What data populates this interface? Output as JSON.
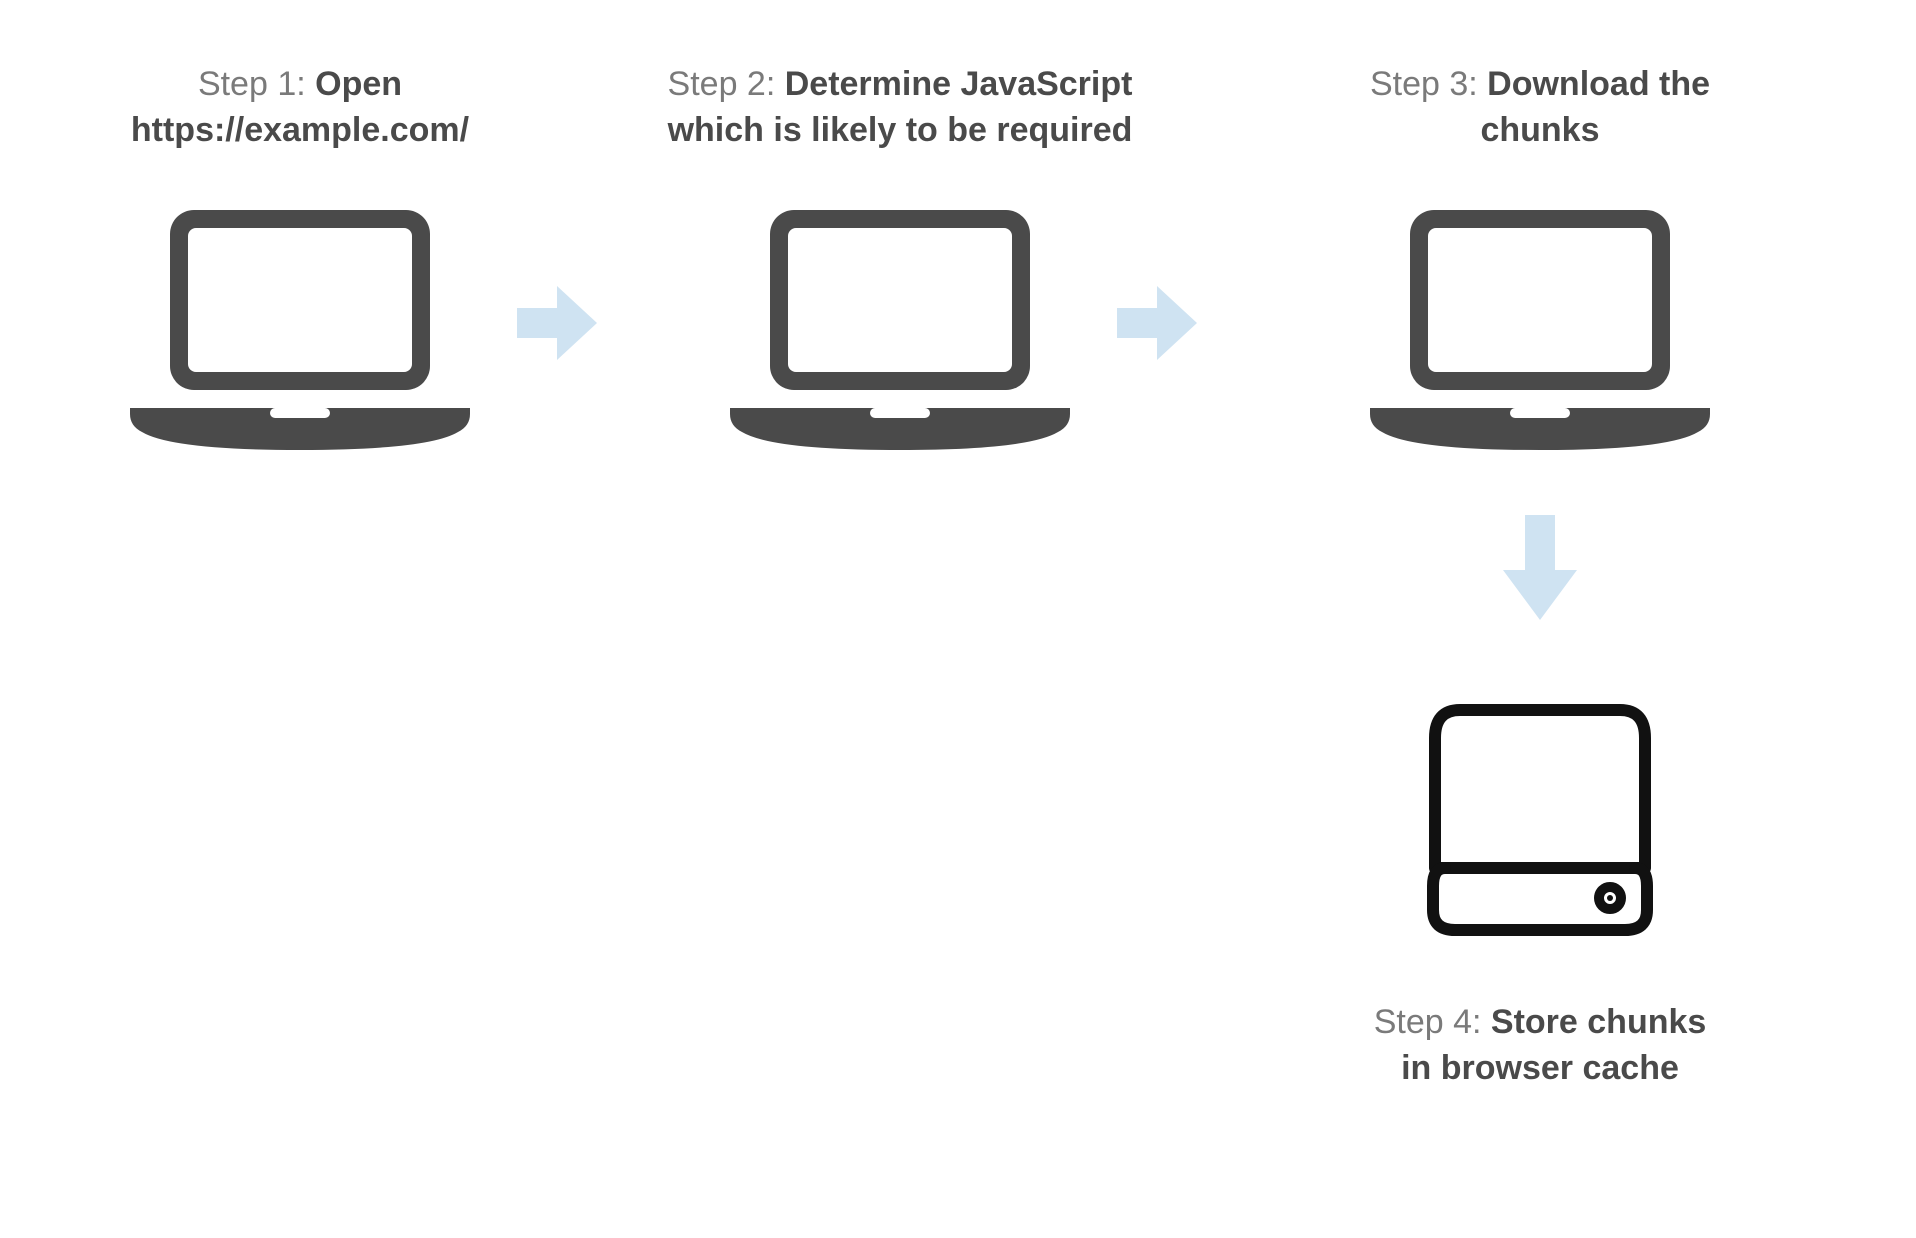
{
  "colors": {
    "icon_dark": "#4a4a4a",
    "arrow_light": "#cfe3f2",
    "drive_stroke": "#111111",
    "text_muted": "#7a7a7a",
    "text_bold": "#4a4a4a"
  },
  "steps": {
    "one": {
      "prefix": "Step 1: ",
      "bold_line1": "Open",
      "bold_line2": "https://example.com/"
    },
    "two": {
      "prefix": "Step 2: ",
      "bold_line1": "Determine JavaScript",
      "bold_line2": "which is likely to be required"
    },
    "three": {
      "prefix": "Step 3: ",
      "bold_line1": "Download the",
      "bold_line2": "chunks"
    },
    "four": {
      "prefix": "Step 4: ",
      "bold_line1": "Store chunks",
      "bold_line2": "in browser cache"
    }
  },
  "icons": {
    "laptop_name": "laptop-icon",
    "drive_name": "hard-drive-icon",
    "arrow_right_name": "arrow-right-icon",
    "arrow_down_name": "arrow-down-icon"
  }
}
